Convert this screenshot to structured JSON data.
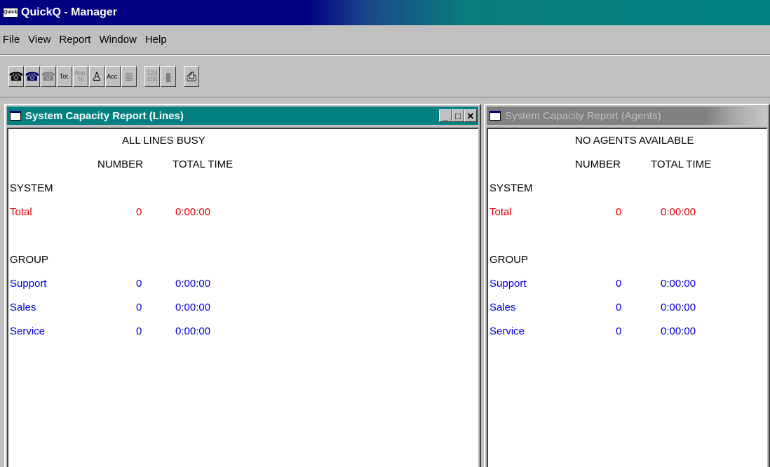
{
  "app": {
    "title": "QuickQ - Manager",
    "icon_label": "QuickQ"
  },
  "menu": [
    "File",
    "View",
    "Report",
    "Window",
    "Help"
  ],
  "toolbar": {
    "tot_label": "Tot.",
    "ave_label": "Ave. %",
    "acc_label": "Acc.",
    "num_label": "123 456"
  },
  "lines_window": {
    "title": "System Capacity Report (Lines)",
    "heading": "ALL LINES BUSY",
    "col_number": "NUMBER",
    "col_time": "TOTAL TIME",
    "system_label": "SYSTEM",
    "total": {
      "label": "Total",
      "number": "0",
      "time": "0:00:00"
    },
    "group_label": "GROUP",
    "groups": [
      {
        "label": "Support",
        "number": "0",
        "time": "0:00:00"
      },
      {
        "label": "Sales",
        "number": "0",
        "time": "0:00:00"
      },
      {
        "label": "Service",
        "number": "0",
        "time": "0:00:00"
      }
    ]
  },
  "agents_window": {
    "title": "System Capacity Report (Agents)",
    "heading": "NO AGENTS AVAILABLE",
    "col_number": "NUMBER",
    "col_time": "TOTAL TIME",
    "system_label": "SYSTEM",
    "total": {
      "label": "Total",
      "number": "0",
      "time": "0:00:00"
    },
    "group_label": "GROUP",
    "groups": [
      {
        "label": "Support",
        "number": "0",
        "time": "0:00:00"
      },
      {
        "label": "Sales",
        "number": "0",
        "time": "0:00:00"
      },
      {
        "label": "Service",
        "number": "0",
        "time": "0:00:00"
      }
    ]
  },
  "colors": {
    "active_title": "#008080",
    "app_title": "#000080",
    "total_row": "#e00000",
    "group_row": "#0000e0"
  }
}
